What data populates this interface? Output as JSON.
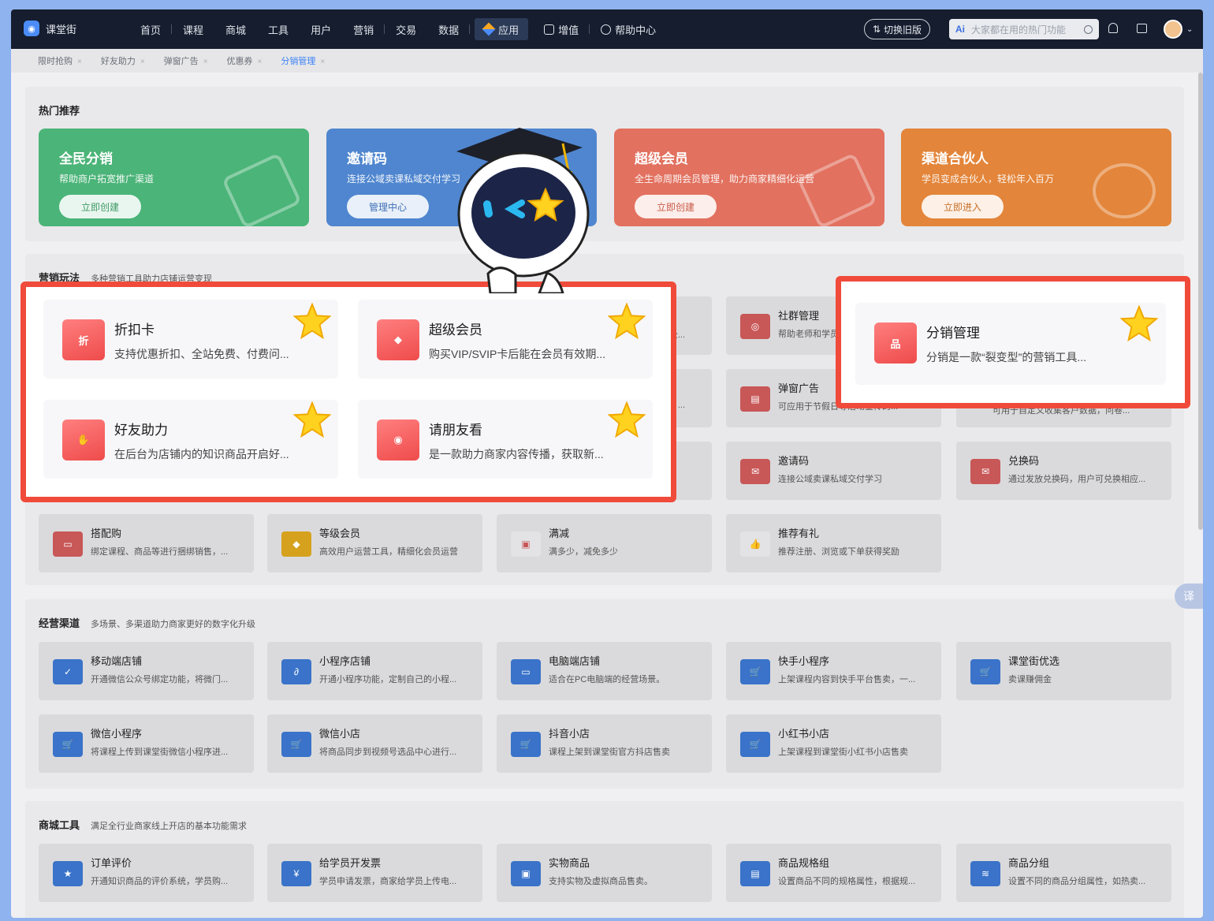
{
  "app": {
    "name": "课堂街"
  },
  "nav": {
    "items": [
      "首页",
      "课程",
      "商城",
      "工具",
      "用户",
      "营销",
      "交易",
      "数据"
    ],
    "active": "应用",
    "extra": [
      "增值",
      "帮助中心"
    ]
  },
  "header": {
    "switch_old": "切换旧版",
    "search_ai": "Ai",
    "search_placeholder": "大家都在用的热门功能"
  },
  "tabs": [
    {
      "label": "限时抢购",
      "active": false
    },
    {
      "label": "好友助力",
      "active": false
    },
    {
      "label": "弹窗广告",
      "active": false
    },
    {
      "label": "优惠券",
      "active": false
    },
    {
      "label": "分销管理",
      "active": true
    }
  ],
  "hot": {
    "title": "热门推荐",
    "banners": [
      {
        "title": "全民分销",
        "desc": "帮助商户拓宽推广渠道",
        "button": "立即创建",
        "color": "#4bb478",
        "btn_color": "#3f9a66"
      },
      {
        "title": "邀请码",
        "desc": "连接公域卖课私域交付学习",
        "button": "管理中心",
        "color": "#4f86cf",
        "btn_color": "#3f6fb4"
      },
      {
        "title": "超级会员",
        "desc": "全生命周期会员管理，助力商家精细化运营",
        "button": "立即创建",
        "color": "#e2715f",
        "btn_color": "#c95a48"
      },
      {
        "title": "渠道合伙人",
        "desc": "学员变成合伙人，轻松年入百万",
        "button": "立即进入",
        "color": "#e3853a",
        "btn_color": "#c86e26"
      }
    ]
  },
  "marketing": {
    "title": "营销玩法",
    "subtitle": "多种营销工具助力店铺运营变现",
    "highlighted": [
      {
        "title": "折扣卡",
        "desc": "支持优惠折扣、全站免费、付费问...",
        "icon": "discount-card-icon",
        "glyph": "折"
      },
      {
        "title": "超级会员",
        "desc": "购买VIP/SVIP卡后能在会员有效期...",
        "icon": "diamond-icon",
        "glyph": "◆"
      },
      {
        "title": "好友助力",
        "desc": "在后台为店铺内的知识商品开启好...",
        "icon": "handshake-icon",
        "glyph": "✋"
      },
      {
        "title": "请朋友看",
        "desc": "是一款助力商家内容传播，获取新...",
        "icon": "eye-icon",
        "glyph": "◉"
      }
    ],
    "featured": {
      "title": "分销管理",
      "desc": "分销是一款“裂变型”的营销工具...",
      "icon": "org-chart-icon",
      "glyph": "品"
    },
    "cards": [
      {
        "title": "社群管理",
        "desc": "帮助老师和学员...",
        "icon": "group-icon",
        "glyph": "◎"
      },
      {
        "title": "弹窗广告",
        "desc": "可应用于节假日等活动宣传的...",
        "icon": "popup-ad-icon",
        "glyph": "▤"
      },
      {
        "title": "邀请码",
        "desc": "连接公域卖课私域交付学习",
        "icon": "invite-code-icon",
        "glyph": "✉"
      },
      {
        "title": "兑换码",
        "desc": "通过发放兑换码，用户可兑换相应...",
        "icon": "redeem-code-icon",
        "glyph": "✉"
      },
      {
        "title": "搭配购",
        "desc": "绑定课程、商品等进行捆绑销售，...",
        "icon": "bundle-icon",
        "glyph": "▭"
      },
      {
        "title": "等级会员",
        "desc": "高效用户运营工具，精细化会员运营",
        "icon": "level-member-icon",
        "glyph": "◆"
      },
      {
        "title": "满减",
        "desc": "满多少，减免多少",
        "icon": "full-reduction-icon",
        "glyph": "▣"
      },
      {
        "title": "推荐有礼",
        "desc": "推荐注册、浏览或下单获得奖励",
        "icon": "thumbs-up-icon",
        "glyph": "👍"
      }
    ],
    "partial_texts": [
      "公...",
      "可用于自定义收集客户数据，问卷...",
      "..."
    ]
  },
  "channels": {
    "title": "经营渠道",
    "subtitle": "多场景、多渠道助力商家更好的数字化升级",
    "cards": [
      {
        "title": "移动端店铺",
        "desc": "开通微信公众号绑定功能，将微门...",
        "icon": "mobile-shop-icon",
        "glyph": "✓"
      },
      {
        "title": "小程序店铺",
        "desc": "开通小程序功能，定制自己的小程...",
        "icon": "mini-program-icon",
        "glyph": "∂"
      },
      {
        "title": "电脑端店铺",
        "desc": "适合在PC电脑端的经营场景。",
        "icon": "desktop-icon",
        "glyph": "▭"
      },
      {
        "title": "快手小程序",
        "desc": "上架课程内容到快手平台售卖，一...",
        "icon": "cart-icon",
        "glyph": "🛒"
      },
      {
        "title": "课堂街优选",
        "desc": "卖课赚佣金",
        "icon": "cart-icon",
        "glyph": "🛒"
      },
      {
        "title": "微信小程序",
        "desc": "将课程上传到课堂街微信小程序进...",
        "icon": "cart-icon",
        "glyph": "🛒"
      },
      {
        "title": "微信小店",
        "desc": "将商品同步到视频号选品中心进行...",
        "icon": "cart-icon",
        "glyph": "🛒"
      },
      {
        "title": "抖音小店",
        "desc": "课程上架到课堂街官方抖店售卖",
        "icon": "cart-icon",
        "glyph": "🛒"
      },
      {
        "title": "小红书小店",
        "desc": "上架课程到课堂街小红书小店售卖",
        "icon": "cart-icon",
        "glyph": "🛒"
      }
    ]
  },
  "mall": {
    "title": "商城工具",
    "subtitle": "满足全行业商家线上开店的基本功能需求",
    "cards": [
      {
        "title": "订单评价",
        "desc": "开通知识商品的评价系统，学员购...",
        "icon": "star-badge-icon",
        "glyph": "★"
      },
      {
        "title": "给学员开发票",
        "desc": "学员申请发票，商家给学员上传电...",
        "icon": "invoice-icon",
        "glyph": "¥"
      },
      {
        "title": "实物商品",
        "desc": "支持实物及虚拟商品售卖。",
        "icon": "package-icon",
        "glyph": "▣"
      },
      {
        "title": "商品规格组",
        "desc": "设置商品不同的规格属性，根据规...",
        "icon": "spec-icon",
        "glyph": "▤"
      },
      {
        "title": "商品分组",
        "desc": "设置不同的商品分组属性，如热卖...",
        "icon": "layers-icon",
        "glyph": "≋"
      }
    ]
  },
  "translate_label": "译"
}
